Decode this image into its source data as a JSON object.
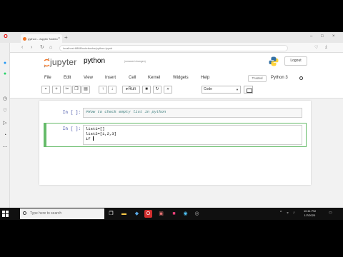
{
  "browser": {
    "tab_title": "python - Jupyter Notebook",
    "new_tab": "+",
    "url": "localhost:8888/notebooks/python.ipynb"
  },
  "jupyter": {
    "logo_text": "jupyter",
    "notebook_name": "python",
    "save_status": "(unsaved changes)",
    "logout_label": "Logout",
    "menu": [
      "File",
      "Edit",
      "View",
      "Insert",
      "Cell",
      "Kernel",
      "Widgets",
      "Help"
    ],
    "trusted_label": "Trusted",
    "kernel_name": "Python 3",
    "toolbar": {
      "run_label": "Run",
      "cell_type": "Code"
    }
  },
  "cells": [
    {
      "prompt": "In [ ]:",
      "code": "#How to check empty list in python"
    },
    {
      "prompt": "In [ ]:",
      "lines": [
        "list1=[]",
        "list2=[1,2,3]",
        "if "
      ]
    }
  ],
  "taskbar": {
    "search_placeholder": "Type here to search",
    "clock_time": "10:11 PM",
    "clock_date": "1/7/2020"
  },
  "colors": {
    "accent_orange": "#f37626",
    "selected_cell_border": "#66bb6a",
    "comment": "#408080",
    "prompt": "#303f9f"
  }
}
